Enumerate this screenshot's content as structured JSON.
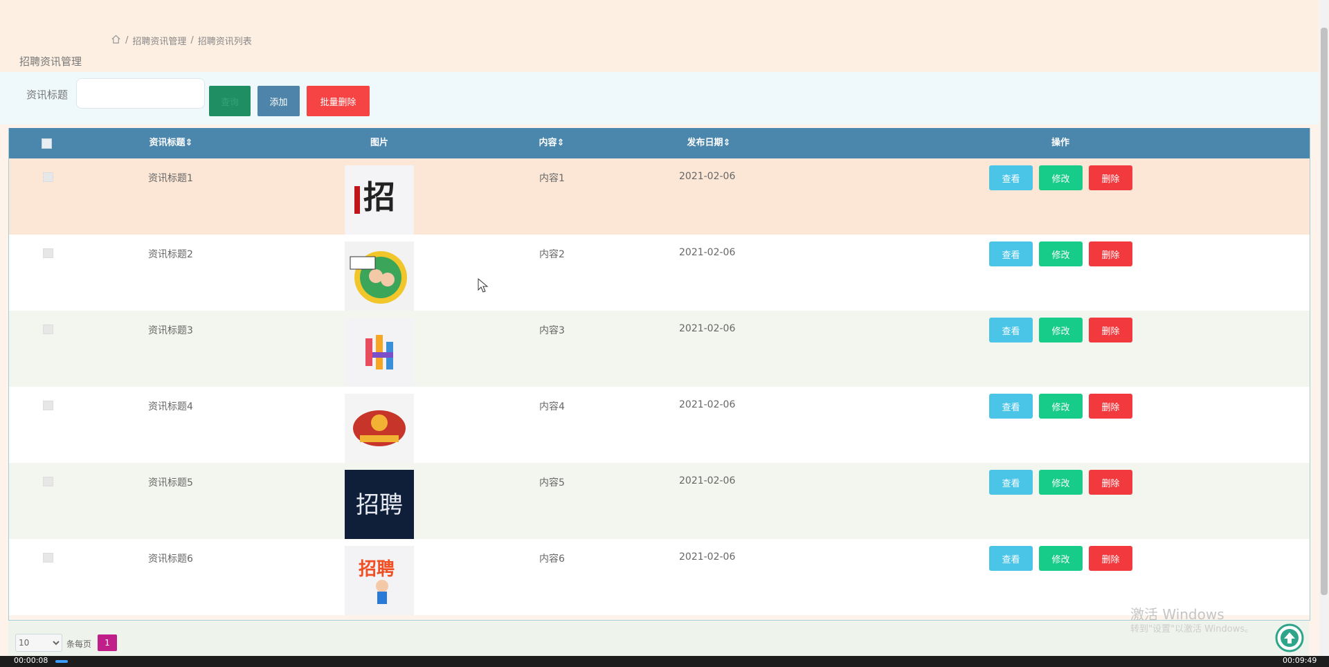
{
  "header": {
    "title": "招聘资讯管理",
    "breadcrumb": [
      "招聘资讯管理",
      "招聘资讯列表"
    ]
  },
  "search": {
    "label": "资讯标题",
    "value": "",
    "search_button": "查询",
    "add_button": "添加",
    "batch_delete_button": "批量删除"
  },
  "table": {
    "columns": [
      "资讯标题",
      "图片",
      "内容",
      "发布日期",
      "操作"
    ],
    "rows": [
      {
        "title": "资讯标题1",
        "content": "内容1",
        "date": "2021-02-06",
        "image": "recruit-image-1"
      },
      {
        "title": "资讯标题2",
        "content": "内容2",
        "date": "2021-02-06",
        "image": "recruit-image-2"
      },
      {
        "title": "资讯标题3",
        "content": "内容3",
        "date": "2021-02-06",
        "image": "recruit-image-3"
      },
      {
        "title": "资讯标题4",
        "content": "内容4",
        "date": "2021-02-06",
        "image": "recruit-image-4"
      },
      {
        "title": "资讯标题5",
        "content": "内容5",
        "date": "2021-02-06",
        "image": "recruit-image-5"
      },
      {
        "title": "资讯标题6",
        "content": "内容6",
        "date": "2021-02-06",
        "image": "recruit-image-6"
      }
    ],
    "actions": {
      "view": "查看",
      "edit": "修改",
      "delete": "删除"
    }
  },
  "pagination": {
    "page_size": "10",
    "per_page_label": "条每页",
    "current_page": "1"
  },
  "watermark": {
    "line1": "激活 Windows",
    "line2": "转到\"设置\"以激活 Windows。"
  },
  "video": {
    "elapsed": "00:00:08",
    "total": "00:09:49"
  },
  "colors": {
    "header_bg": "#fdefe2",
    "table_header": "#4b87ad",
    "view_button": "#4ac4e7",
    "edit_button": "#17cc89",
    "delete_button": "#f1393e",
    "page_active": "#c01f8a"
  }
}
